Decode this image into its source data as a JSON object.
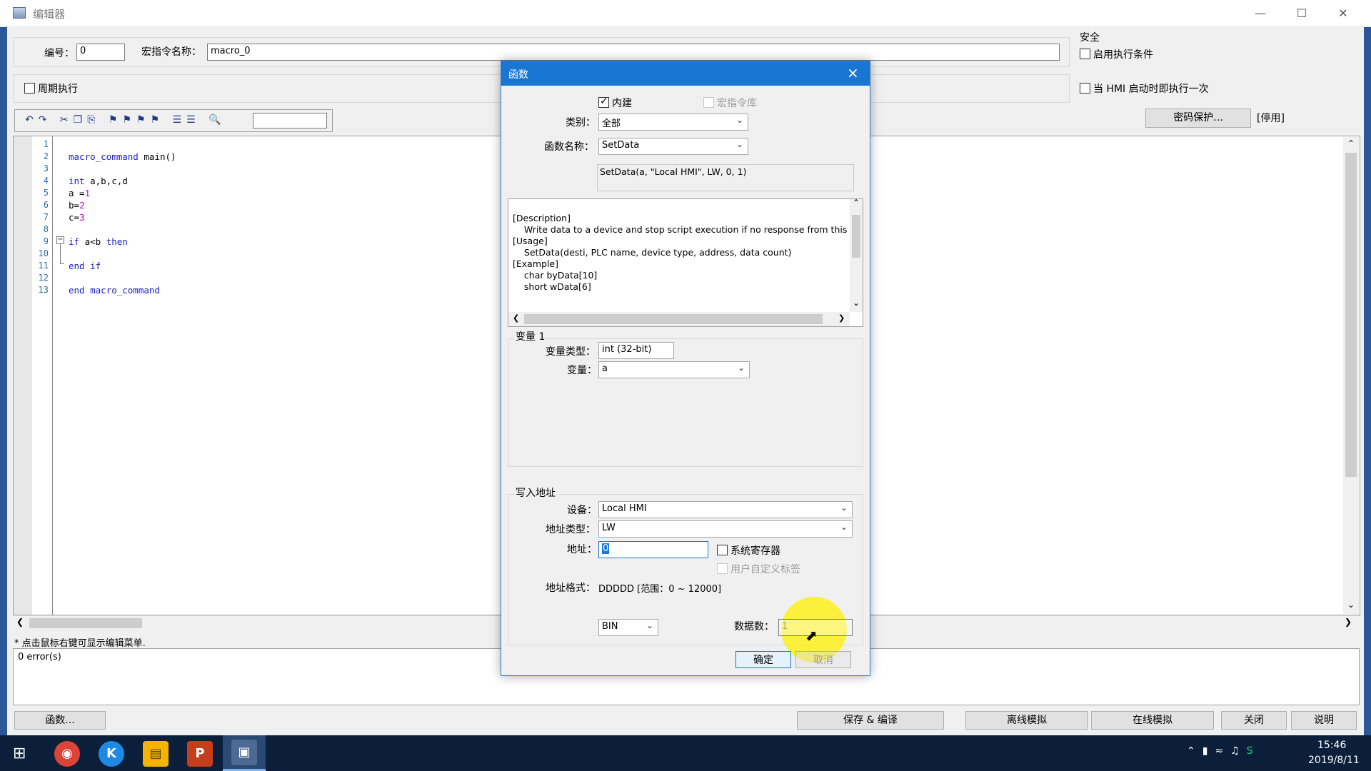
{
  "window": {
    "title": "编辑器"
  },
  "top": {
    "number_label": "编号：",
    "number_value": "0",
    "macro_name_label": "宏指令名称：",
    "macro_name_value": "macro_0",
    "periodic_label": "周期执行"
  },
  "security": {
    "group_label": "安全",
    "enable_condition_label": "启用执行条件",
    "run_once_label": "当 HMI 启动时即执行一次",
    "password_button": "密码保护...",
    "status": "[停用]"
  },
  "editor": {
    "line_numbers": [
      "1",
      "2",
      "3",
      "4",
      "5",
      "6",
      "7",
      "8",
      "9",
      "10",
      "11",
      "12",
      "13"
    ],
    "lines": [
      "",
      "macro_command main()",
      "",
      "int a,b,c,d",
      "a =1",
      "b=2",
      "c=3",
      "",
      "if a<b then",
      "",
      "end if",
      "",
      "end macro_command"
    ],
    "hint": "* 点击鼠标右键可显示编辑菜单.",
    "errors": "0 error(s)"
  },
  "bottom_buttons": {
    "functions": "函数...",
    "save_compile": "保存 & 编译",
    "offline_sim": "离线模拟",
    "online_sim": "在线模拟",
    "close": "关闭",
    "help": "说明"
  },
  "dialog": {
    "title": "函数",
    "builtin_label": "内建",
    "library_label": "宏指令库",
    "category_label": "类别：",
    "category_value": "全部",
    "function_name_label": "函数名称：",
    "function_name_value": "SetData",
    "signature": "SetData(a, \"Local HMI\", LW, 0, 1)",
    "description_lines": [
      "[Description]",
      "    Write data to a device and stop script execution if no response from this device",
      "",
      "[Usage]",
      "    SetData(desti, PLC name, device type, address, data count)",
      "",
      "[Example]",
      "    char byData[10]",
      "    short wData[6]"
    ],
    "var_group_label": "变量 1",
    "var_type_label": "变量类型：",
    "var_type_value": "int (32-bit)",
    "var_label": "变量：",
    "var_value": "a",
    "write_group_label": "写入地址",
    "device_label": "设备：",
    "device_value": "Local HMI",
    "address_type_label": "地址类型：",
    "address_type_value": "LW",
    "address_label": "地址：",
    "address_value": "0",
    "system_register_label": "系统寄存器",
    "user_tag_label": "用户自定义标签",
    "address_format_label": "地址格式：",
    "address_format_value": "DDDDD [范围：0 ~ 12000]",
    "format_value": "BIN",
    "data_count_label": "数据数：",
    "data_count_value": "1",
    "ok_button": "确定",
    "cancel_button": "取消"
  },
  "taskbar": {
    "time": "15:46",
    "date": "2019/8/11"
  },
  "colors": {
    "titlebar_blue": "#1976d2",
    "taskbar": "#0b1f3a",
    "keyword": "#1c1cc0",
    "number": "#d000d0"
  }
}
